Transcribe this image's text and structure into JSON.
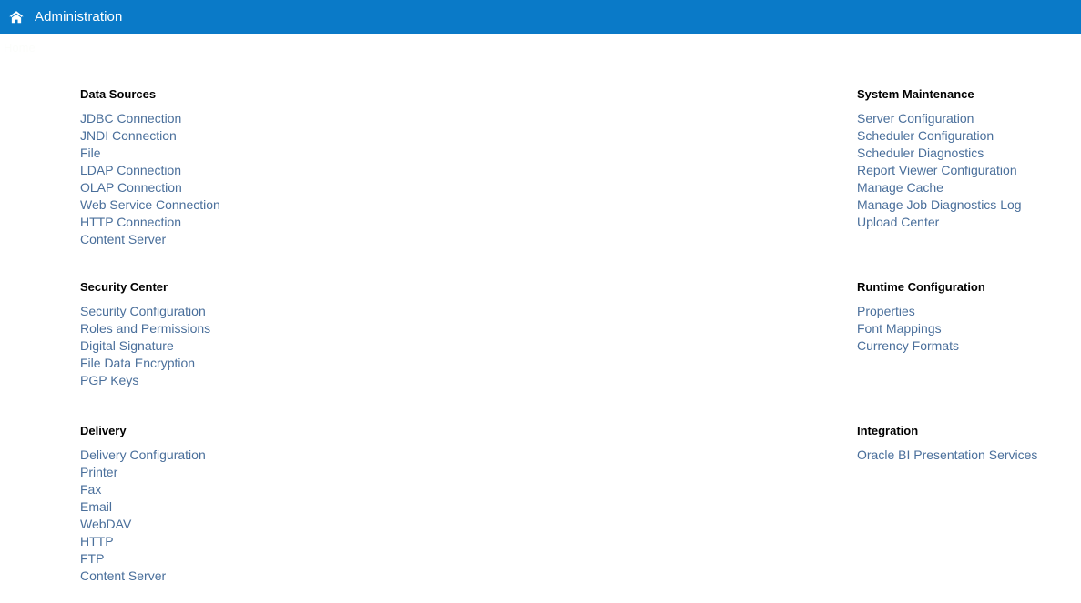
{
  "topbar": {
    "home_icon": "home-icon",
    "title": "Administration",
    "background_color": "#0a7ac8",
    "text_color": "#ffffff"
  },
  "ghost_text": "Home",
  "theme": {
    "link_color": "#4a6f9b",
    "heading_color": "#000000",
    "page_background": "#ffffff"
  },
  "columns": {
    "left": [
      {
        "title": "Data Sources",
        "links": [
          "JDBC Connection",
          "JNDI Connection",
          "File",
          "LDAP Connection",
          "OLAP Connection",
          "Web Service Connection",
          "HTTP Connection",
          "Content Server"
        ]
      },
      {
        "title": "Security Center",
        "links": [
          "Security Configuration",
          "Roles and Permissions",
          "Digital Signature",
          "File Data Encryption",
          "PGP Keys"
        ]
      },
      {
        "title": "Delivery",
        "links": [
          "Delivery Configuration",
          "Printer",
          "Fax",
          "Email",
          "WebDAV",
          "HTTP",
          "FTP",
          "Content Server"
        ]
      }
    ],
    "right": [
      {
        "title": "System Maintenance",
        "links": [
          "Server Configuration",
          "Scheduler Configuration",
          "Scheduler Diagnostics",
          "Report Viewer Configuration",
          "Manage Cache",
          "Manage Job Diagnostics Log",
          "Upload Center"
        ]
      },
      {
        "title": "Runtime Configuration",
        "links": [
          "Properties",
          "Font Mappings",
          "Currency Formats"
        ]
      },
      {
        "title": "Integration",
        "links": [
          "Oracle BI Presentation Services"
        ]
      }
    ]
  }
}
